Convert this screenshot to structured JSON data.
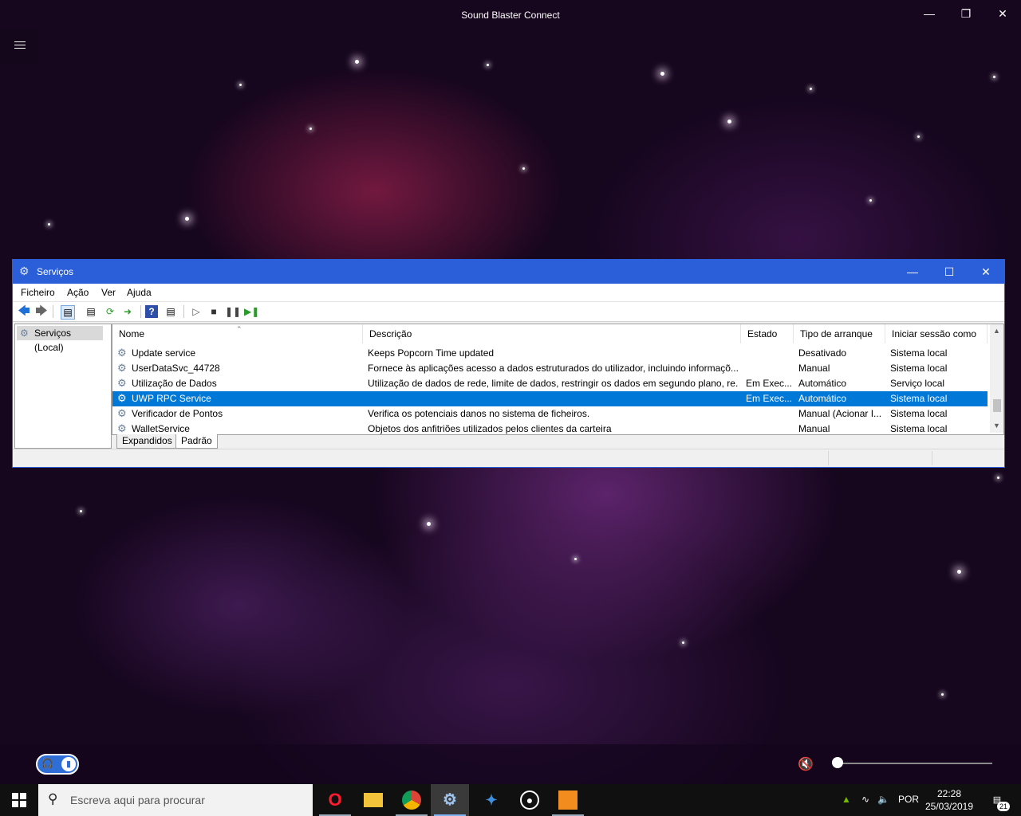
{
  "app": {
    "title": "Sound Blaster Connect",
    "icons": {
      "menu": "hamburger-menu-icon",
      "minimize": "minimize-icon",
      "restore": "restore-icon",
      "close": "close-icon"
    }
  },
  "services_window": {
    "title": "Serviços",
    "menu": [
      "Ficheiro",
      "Ação",
      "Ver",
      "Ajuda"
    ],
    "tree_item": "Serviços (Local)",
    "columns": [
      "Nome",
      "Descrição",
      "Estado",
      "Tipo de arranque",
      "Iniciar sessão como"
    ],
    "rows": [
      {
        "name": "Update service",
        "description": "Keeps Popcorn Time updated",
        "status": "",
        "startup": "Desativado",
        "logon": "Sistema local"
      },
      {
        "name": "UserDataSvc_44728",
        "description": "Fornece às aplicações acesso a dados estruturados do utilizador, incluindo informaçõ...",
        "status": "",
        "startup": "Manual",
        "logon": "Sistema local"
      },
      {
        "name": "Utilização de Dados",
        "description": "Utilização de dados de rede, limite de dados, restringir os dados em segundo plano, re...",
        "status": "Em Exec...",
        "startup": "Automático",
        "logon": "Serviço local"
      },
      {
        "name": "UWP RPC Service",
        "description": "",
        "status": "Em Exec...",
        "startup": "Automático",
        "logon": "Sistema local"
      },
      {
        "name": "Verificador de Pontos",
        "description": "Verifica os potenciais danos no sistema de ficheiros.",
        "status": "",
        "startup": "Manual (Acionar I...",
        "logon": "Sistema local"
      },
      {
        "name": "WalletService",
        "description": "Objetos dos anfitriões utilizados pelos clientes da carteira",
        "status": "",
        "startup": "Manual",
        "logon": "Sistema local"
      }
    ],
    "selected_row_index": 3,
    "tabs": [
      "Expandidos",
      "Padrão"
    ],
    "accent_color": "#2b5fd9",
    "selection_color": "#0078d7",
    "highlight_colors": {
      "row_box": "#e81123",
      "status_box": "#000000"
    }
  },
  "bottom_bar": {
    "toggle_icons": [
      "headphones-icon",
      "speaker-icon"
    ],
    "volume_icon": "volume-muted-icon",
    "volume_level": 0
  },
  "taskbar": {
    "search_placeholder": "Escreva aqui para procurar",
    "apps": [
      "opera-icon",
      "file-explorer-icon",
      "chrome-icon",
      "services-gear-icon",
      "app-icon",
      "steam-icon",
      "sound-blaster-icon"
    ],
    "language": "POR",
    "time": "22:28",
    "date": "25/03/2019",
    "notifications": "21"
  }
}
